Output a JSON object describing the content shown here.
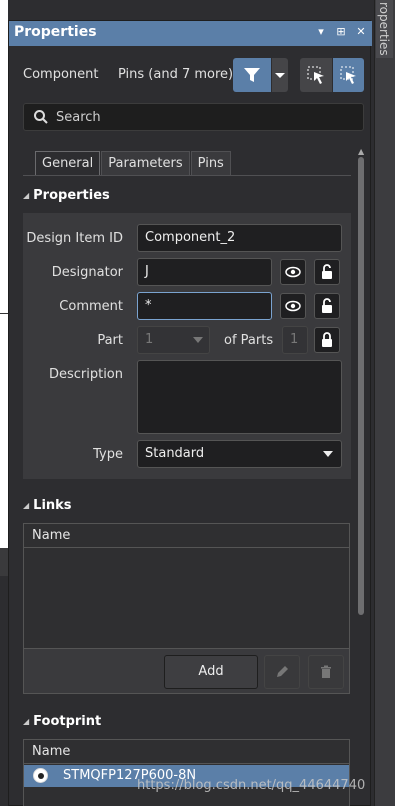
{
  "panel": {
    "title": "Properties",
    "side_tab": "roperties",
    "titlebar_icons": [
      "▾",
      "⊞",
      "✕"
    ]
  },
  "header": {
    "object_kind": "Component",
    "filter_summary": "Pins (and 7 more)"
  },
  "search": {
    "placeholder": "Search"
  },
  "tabs": [
    "General",
    "Parameters",
    "Pins"
  ],
  "properties": {
    "section_title": "Properties",
    "design_item_id_label": "Design Item ID",
    "design_item_id_value": "Component_2",
    "designator_label": "Designator",
    "designator_value": "J",
    "comment_label": "Comment",
    "comment_value": "*",
    "part_label": "Part",
    "part_value": "1",
    "of_parts_label": "of Parts",
    "of_parts_value": "1",
    "description_label": "Description",
    "description_value": "",
    "type_label": "Type",
    "type_value": "Standard"
  },
  "links": {
    "section_title": "Links",
    "column_name": "Name",
    "add_label": "Add"
  },
  "footprint": {
    "section_title": "Footprint",
    "column_name": "Name",
    "rows": [
      "STMQFP127P600-8N"
    ]
  },
  "watermark": "https://blog.csdn.net/qq_44644740",
  "colors": {
    "accent": "#5b7fa8",
    "panel_bg": "#2d2d30",
    "field_bg": "#1f1f21"
  }
}
